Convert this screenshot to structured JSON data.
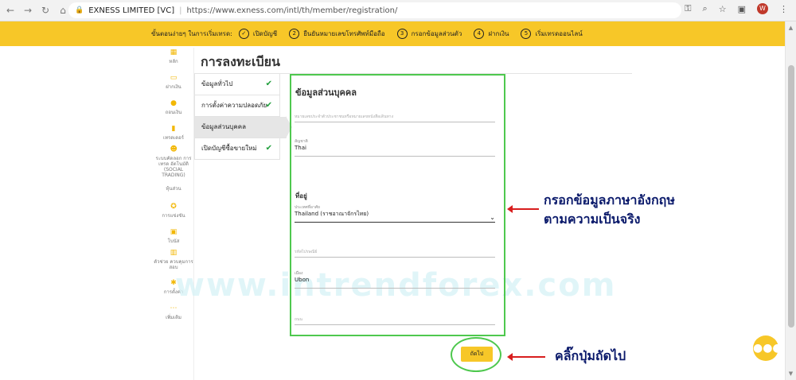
{
  "browser": {
    "site_name": "EXNESS LIMITED [VC]",
    "separator": "|",
    "url": "https://www.exness.com/intl/th/member/registration/",
    "avatar_letter": "W"
  },
  "steps": {
    "lead": "ขั้นตอนง่ายๆ ในการเริ่มเทรด:",
    "items": [
      {
        "num": "✓",
        "label": "เปิดบัญชี"
      },
      {
        "num": "2",
        "label": "ยืนยันหมายเลขโทรศัพท์มือถือ"
      },
      {
        "num": "3",
        "label": "กรอกข้อมูลส่วนตัว"
      },
      {
        "num": "4",
        "label": "ฝากเงิน"
      },
      {
        "num": "5",
        "label": "เริ่มเทรดออนไลน์"
      }
    ]
  },
  "sidebar": {
    "items": [
      {
        "icon": "grid-icon",
        "label": "หลัก"
      },
      {
        "icon": "wallet-icon",
        "label": "ฝากเงิน"
      },
      {
        "icon": "coin-icon",
        "label": "ถอนเงิน"
      },
      {
        "icon": "chart-icon",
        "label": "เทรดเดอร์"
      },
      {
        "icon": "people-icon",
        "label": "ระบบคัดลอก การเทรด อัตโนมัติ (SOCIAL TRADING)"
      },
      {
        "icon": "partner-icon",
        "label": "หุ้นส่วน"
      },
      {
        "icon": "medal-icon",
        "label": "การแข่งขัน"
      },
      {
        "icon": "gift-icon",
        "label": "โบนัส"
      },
      {
        "icon": "analytics-icon",
        "label": "ตัวช่วย ควบคุมการ สอบ"
      },
      {
        "icon": "gear-icon",
        "label": "การตั้งค่า"
      },
      {
        "icon": "more-icon",
        "label": "เพิ่มเติม"
      }
    ]
  },
  "page": {
    "title": "การลงทะเบียน"
  },
  "sections": [
    {
      "label": "ข้อมูลทั่วไป",
      "done": true
    },
    {
      "label": "การตั้งค่าความปลอดภัย",
      "done": true
    },
    {
      "label": "ข้อมูลส่วนบุคคล",
      "done": false
    },
    {
      "label": "เปิดบัญชีซื้อขายใหม่",
      "done": true
    }
  ],
  "form": {
    "title": "ข้อมูลส่วนบุคคล",
    "id_placeholder": "หมายเลขประจำตัวประชาชนหรือหมายเลขหนังสือเดินทาง",
    "nationality_label": "สัญชาติ",
    "nationality_value": "Thai",
    "address_heading": "ที่อยู่",
    "country_label": "ประเทศที่อาศัย",
    "country_value": "Thailand (ราชอาณาจักรไทย)",
    "postcode_placeholder": "รหัสไปรษณีย์",
    "city_label": "เมือง",
    "city_value": "Ubon",
    "street_placeholder": "ถนน"
  },
  "next_label": "ถัดไป",
  "annotations": {
    "fill_line1": "กรอกข้อมูลภาษาอังกฤษ",
    "fill_line2": "ตามความเป็นจริง",
    "click_next": "คลิ๊กปุ่มถัดไป"
  },
  "watermark": "www.intrendforex.com",
  "colors": {
    "brand_yellow": "#f7c728",
    "highlight_green": "#4ec84e",
    "annotation_red": "#d81e1e",
    "annotation_text": "#0b1a6b"
  }
}
